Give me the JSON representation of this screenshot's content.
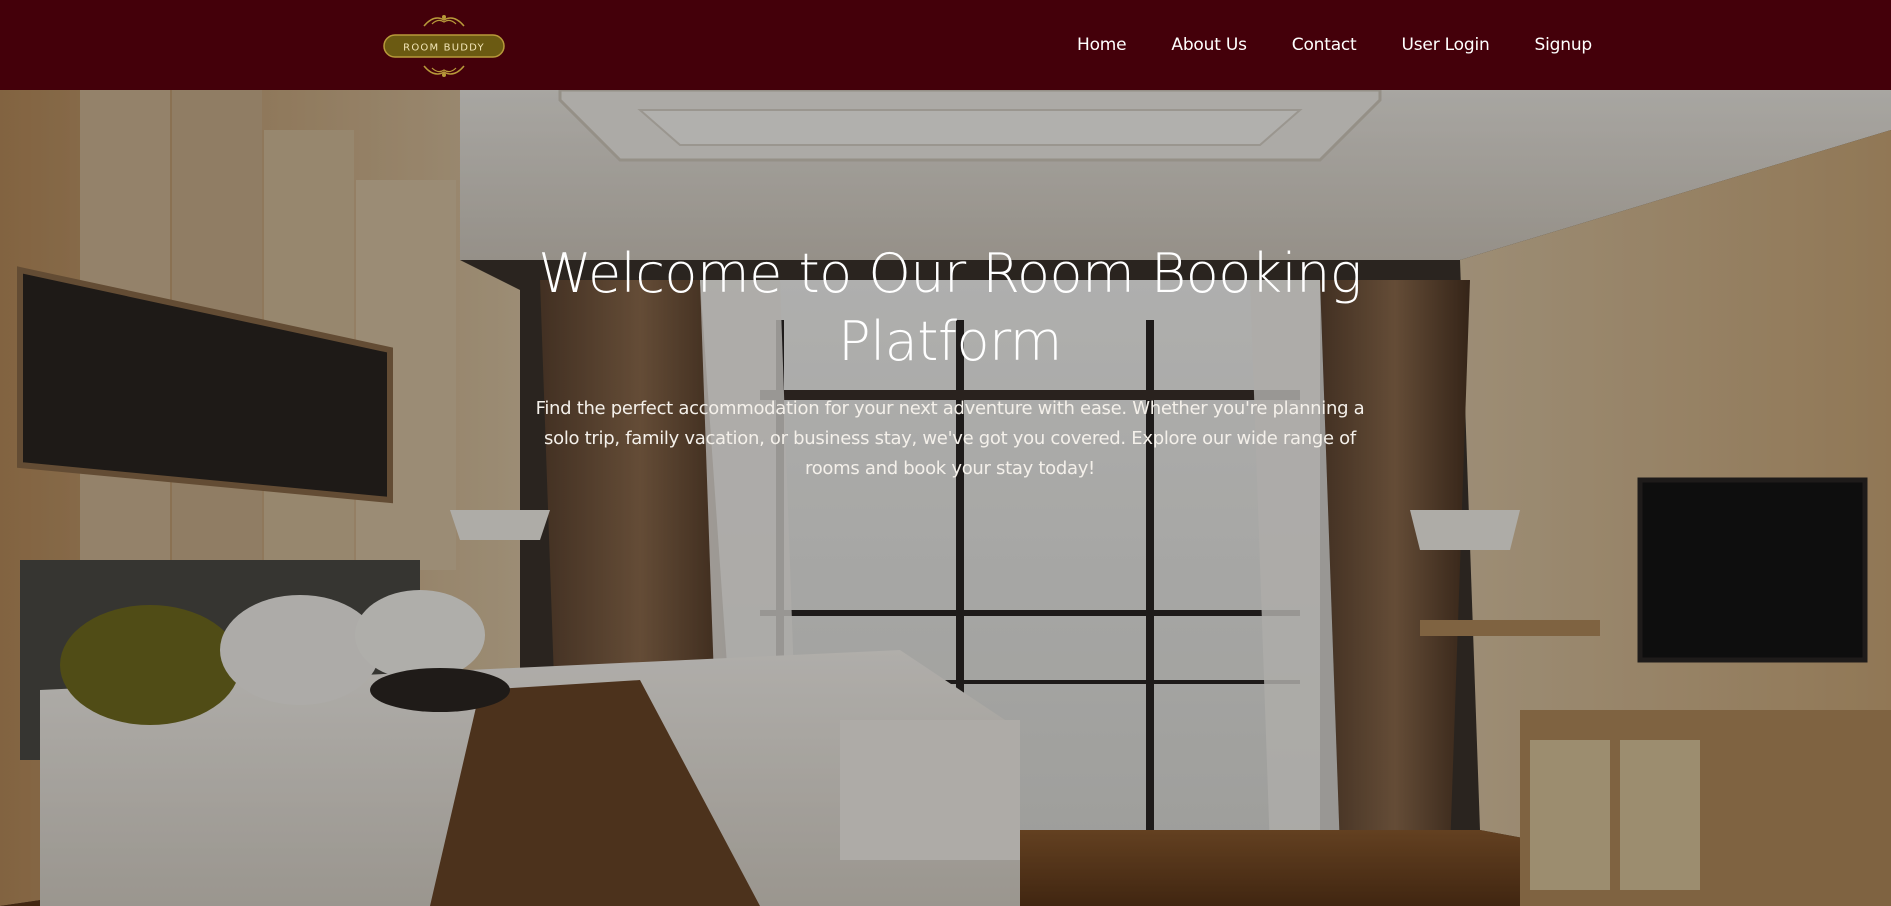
{
  "logo": {
    "text": "ROOM BUDDY"
  },
  "nav": {
    "items": [
      {
        "label": "Home"
      },
      {
        "label": "About Us"
      },
      {
        "label": "Contact"
      },
      {
        "label": "User Login"
      },
      {
        "label": "Signup"
      }
    ]
  },
  "hero": {
    "title": "Welcome to Our Room Booking Platform",
    "text": "Find the perfect accommodation for your next adventure with ease. Whether you're planning a solo trip, family vacation, or business stay, we've got you covered. Explore our wide range of rooms and book your stay today!",
    "background": "hotel-bedroom-photo"
  },
  "colors": {
    "navbar": "#44000a",
    "logo_badge": "#6b5a12",
    "logo_ornament": "#b89a3a",
    "text": "#ffffff"
  }
}
